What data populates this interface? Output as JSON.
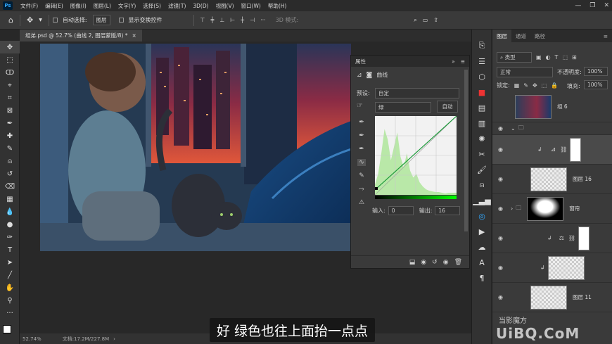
{
  "app": {
    "logo": "Ps"
  },
  "menu": [
    "文件(F)",
    "编辑(E)",
    "图像(I)",
    "图层(L)",
    "文字(Y)",
    "选择(S)",
    "滤镜(T)",
    "3D(D)",
    "视图(V)",
    "窗口(W)",
    "帮助(H)"
  ],
  "options": {
    "auto_select_label": "自动选择:",
    "auto_select_value": "图层",
    "show_transform_label": "显示变换控件",
    "mode_3d": "3D 模式:",
    "more": "···"
  },
  "document": {
    "tab_title": "组弟.psd @ 52.7% (曲线 2, 图层蒙版/8) *",
    "close": "×"
  },
  "status": {
    "zoom": "52.74%",
    "doc_info": "文档:17.2M/227.8M",
    "arrow": "›"
  },
  "properties": {
    "title": "属性",
    "type_label": "曲线",
    "preset_label": "预设:",
    "preset_value": "自定",
    "channel_value": "绿",
    "auto_button": "自动",
    "input_label": "输入:",
    "input_value": "0",
    "output_label": "输出:",
    "output_value": "16",
    "collapse": "»",
    "menu": "≡"
  },
  "layers_panel": {
    "tabs": [
      "图层",
      "通道",
      "路径"
    ],
    "kind_label": "类型",
    "blend_mode": "正常",
    "opacity_label": "不透明度:",
    "opacity_value": "100%",
    "lock_label": "锁定:",
    "fill_label": "填充:",
    "fill_value": "100%",
    "layers": [
      {
        "name": "组 6"
      },
      {
        "name": ""
      },
      {
        "name": ""
      },
      {
        "name": "图层 16"
      },
      {
        "name": "窗帘"
      },
      {
        "name": ""
      },
      {
        "name": ""
      },
      {
        "name": "图层 11"
      }
    ]
  },
  "subtitle": "好 绿色也往上面抬一点点",
  "watermark": {
    "line1": "UiBQ.CoM",
    "line2": "当影魔方"
  },
  "colors": {
    "accent": "#31a8ff",
    "curve_green": "#1e9b3c",
    "histogram": "#b9e8a8"
  }
}
